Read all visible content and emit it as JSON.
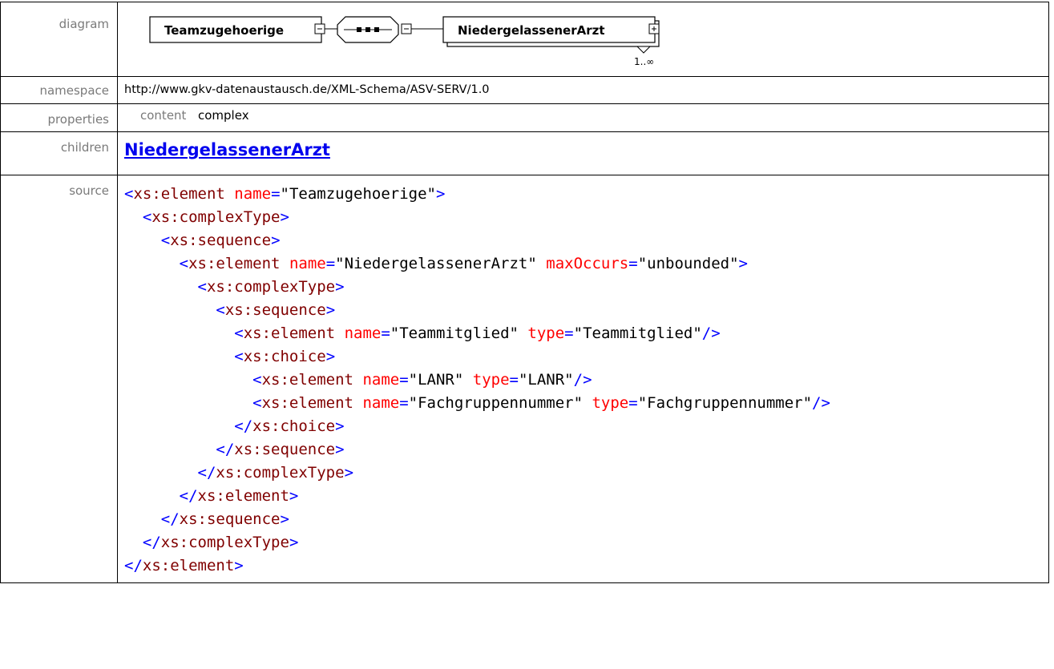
{
  "labels": {
    "diagram": "diagram",
    "namespace": "namespace",
    "properties": "properties",
    "children": "children",
    "source": "source"
  },
  "diagram": {
    "root_element": "Teamzugehoerige",
    "child_element": "NiedergelassenerArzt",
    "child_cardinality": "1..∞",
    "compositor": "sequence"
  },
  "namespace": "http://www.gkv-datenaustausch.de/XML-Schema/ASV-SERV/1.0",
  "properties": {
    "key": "content",
    "value": "complex"
  },
  "children": [
    "NiedergelassenerArzt"
  ],
  "source_lines": [
    [
      {
        "c": "brk",
        "t": "<"
      },
      {
        "c": "tag",
        "t": "xs:element"
      },
      {
        "c": "val",
        "t": " "
      },
      {
        "c": "attr",
        "t": "name"
      },
      {
        "c": "eq",
        "t": "="
      },
      {
        "c": "val",
        "t": "\"Teamzugehoerige\""
      },
      {
        "c": "brk",
        "t": ">"
      }
    ],
    [
      {
        "c": "val",
        "t": "  "
      },
      {
        "c": "brk",
        "t": "<"
      },
      {
        "c": "tag",
        "t": "xs:complexType"
      },
      {
        "c": "brk",
        "t": ">"
      }
    ],
    [
      {
        "c": "val",
        "t": "    "
      },
      {
        "c": "brk",
        "t": "<"
      },
      {
        "c": "tag",
        "t": "xs:sequence"
      },
      {
        "c": "brk",
        "t": ">"
      }
    ],
    [
      {
        "c": "val",
        "t": "      "
      },
      {
        "c": "brk",
        "t": "<"
      },
      {
        "c": "tag",
        "t": "xs:element"
      },
      {
        "c": "val",
        "t": " "
      },
      {
        "c": "attr",
        "t": "name"
      },
      {
        "c": "eq",
        "t": "="
      },
      {
        "c": "val",
        "t": "\"NiedergelassenerArzt\""
      },
      {
        "c": "val",
        "t": " "
      },
      {
        "c": "attr",
        "t": "maxOccurs"
      },
      {
        "c": "eq",
        "t": "="
      },
      {
        "c": "val",
        "t": "\"unbounded\""
      },
      {
        "c": "brk",
        "t": ">"
      }
    ],
    [
      {
        "c": "val",
        "t": "        "
      },
      {
        "c": "brk",
        "t": "<"
      },
      {
        "c": "tag",
        "t": "xs:complexType"
      },
      {
        "c": "brk",
        "t": ">"
      }
    ],
    [
      {
        "c": "val",
        "t": "          "
      },
      {
        "c": "brk",
        "t": "<"
      },
      {
        "c": "tag",
        "t": "xs:sequence"
      },
      {
        "c": "brk",
        "t": ">"
      }
    ],
    [
      {
        "c": "val",
        "t": "            "
      },
      {
        "c": "brk",
        "t": "<"
      },
      {
        "c": "tag",
        "t": "xs:element"
      },
      {
        "c": "val",
        "t": " "
      },
      {
        "c": "attr",
        "t": "name"
      },
      {
        "c": "eq",
        "t": "="
      },
      {
        "c": "val",
        "t": "\"Teammitglied\""
      },
      {
        "c": "val",
        "t": " "
      },
      {
        "c": "attr",
        "t": "type"
      },
      {
        "c": "eq",
        "t": "="
      },
      {
        "c": "val",
        "t": "\"Teammitglied\""
      },
      {
        "c": "brk",
        "t": "/>"
      }
    ],
    [
      {
        "c": "val",
        "t": "            "
      },
      {
        "c": "brk",
        "t": "<"
      },
      {
        "c": "tag",
        "t": "xs:choice"
      },
      {
        "c": "brk",
        "t": ">"
      }
    ],
    [
      {
        "c": "val",
        "t": "              "
      },
      {
        "c": "brk",
        "t": "<"
      },
      {
        "c": "tag",
        "t": "xs:element"
      },
      {
        "c": "val",
        "t": " "
      },
      {
        "c": "attr",
        "t": "name"
      },
      {
        "c": "eq",
        "t": "="
      },
      {
        "c": "val",
        "t": "\"LANR\""
      },
      {
        "c": "val",
        "t": " "
      },
      {
        "c": "attr",
        "t": "type"
      },
      {
        "c": "eq",
        "t": "="
      },
      {
        "c": "val",
        "t": "\"LANR\""
      },
      {
        "c": "brk",
        "t": "/>"
      }
    ],
    [
      {
        "c": "val",
        "t": "              "
      },
      {
        "c": "brk",
        "t": "<"
      },
      {
        "c": "tag",
        "t": "xs:element"
      },
      {
        "c": "val",
        "t": " "
      },
      {
        "c": "attr",
        "t": "name"
      },
      {
        "c": "eq",
        "t": "="
      },
      {
        "c": "val",
        "t": "\"Fachgruppennummer\""
      },
      {
        "c": "val",
        "t": " "
      },
      {
        "c": "attr",
        "t": "type"
      },
      {
        "c": "eq",
        "t": "="
      },
      {
        "c": "val",
        "t": "\"Fachgruppennummer\""
      },
      {
        "c": "brk",
        "t": "/>"
      }
    ],
    [
      {
        "c": "val",
        "t": "            "
      },
      {
        "c": "brk",
        "t": "</"
      },
      {
        "c": "tag",
        "t": "xs:choice"
      },
      {
        "c": "brk",
        "t": ">"
      }
    ],
    [
      {
        "c": "val",
        "t": "          "
      },
      {
        "c": "brk",
        "t": "</"
      },
      {
        "c": "tag",
        "t": "xs:sequence"
      },
      {
        "c": "brk",
        "t": ">"
      }
    ],
    [
      {
        "c": "val",
        "t": "        "
      },
      {
        "c": "brk",
        "t": "</"
      },
      {
        "c": "tag",
        "t": "xs:complexType"
      },
      {
        "c": "brk",
        "t": ">"
      }
    ],
    [
      {
        "c": "val",
        "t": "      "
      },
      {
        "c": "brk",
        "t": "</"
      },
      {
        "c": "tag",
        "t": "xs:element"
      },
      {
        "c": "brk",
        "t": ">"
      }
    ],
    [
      {
        "c": "val",
        "t": "    "
      },
      {
        "c": "brk",
        "t": "</"
      },
      {
        "c": "tag",
        "t": "xs:sequence"
      },
      {
        "c": "brk",
        "t": ">"
      }
    ],
    [
      {
        "c": "val",
        "t": "  "
      },
      {
        "c": "brk",
        "t": "</"
      },
      {
        "c": "tag",
        "t": "xs:complexType"
      },
      {
        "c": "brk",
        "t": ">"
      }
    ],
    [
      {
        "c": "brk",
        "t": "</"
      },
      {
        "c": "tag",
        "t": "xs:element"
      },
      {
        "c": "brk",
        "t": ">"
      }
    ]
  ],
  "colors": {
    "tag": "#800000",
    "bracket": "#0000ff",
    "attribute": "#ff0000",
    "label": "#7a7a7a",
    "link": "#0000ee"
  }
}
